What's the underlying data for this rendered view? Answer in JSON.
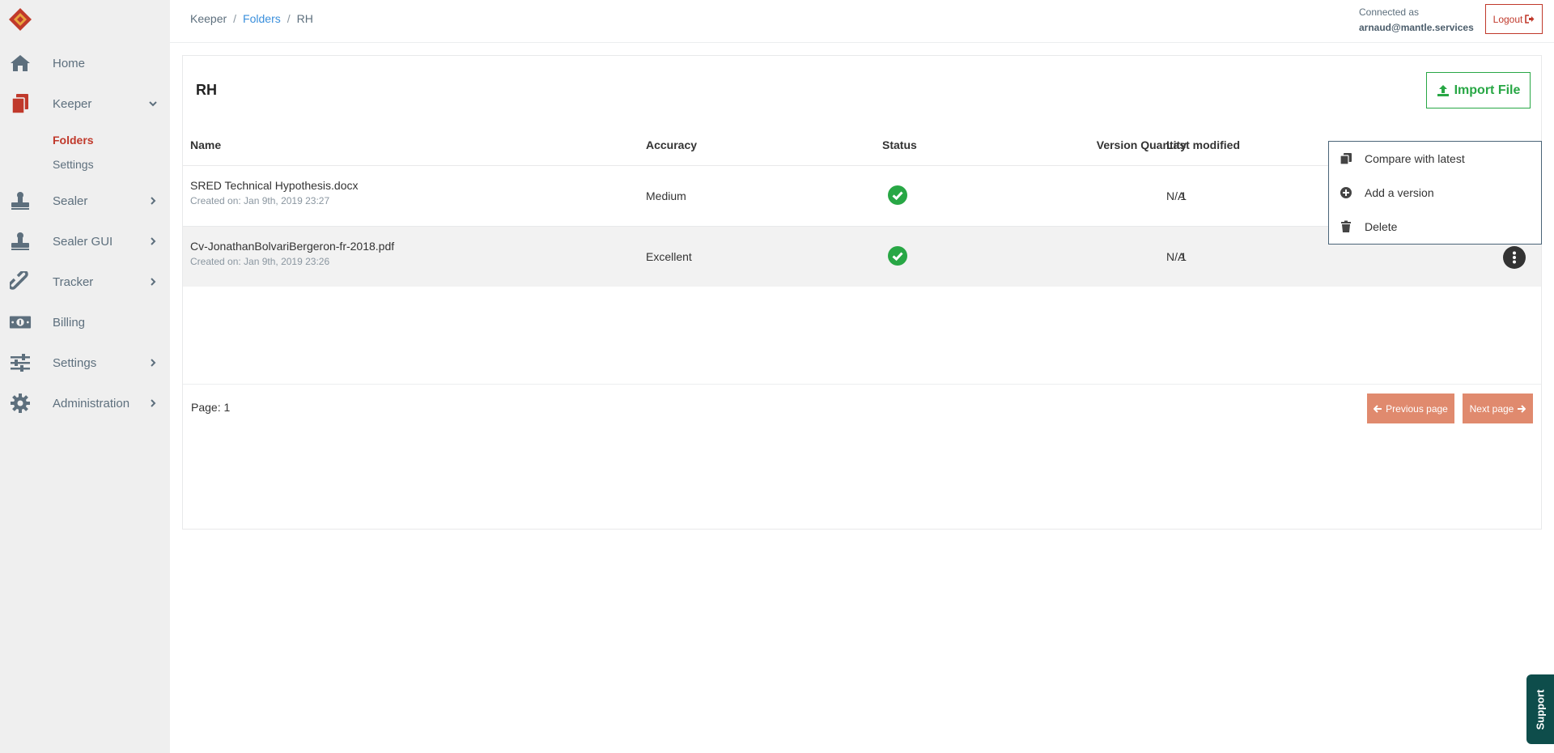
{
  "sidebar": {
    "items": [
      {
        "label": "Home"
      },
      {
        "label": "Keeper"
      },
      {
        "label": "Sealer"
      },
      {
        "label": "Sealer GUI"
      },
      {
        "label": "Tracker"
      },
      {
        "label": "Billing"
      },
      {
        "label": "Settings"
      },
      {
        "label": "Administration"
      }
    ],
    "keeper_sub": [
      {
        "label": "Folders"
      },
      {
        "label": "Settings"
      }
    ]
  },
  "header": {
    "breadcrumb": [
      "Keeper",
      "Folders",
      "RH"
    ],
    "breadcrumb_sep": "/",
    "connected_label": "Connected as",
    "user_email": "arnaud@mantle.services",
    "logout_label": "Logout"
  },
  "folder": {
    "title": "RH",
    "import_label": "Import File"
  },
  "table": {
    "headers": {
      "name": "Name",
      "accuracy": "Accuracy",
      "status": "Status",
      "version_quantity": "Version Quantity",
      "last_modified": "Last modified"
    },
    "rows": [
      {
        "name": "SRED Technical Hypothesis.docx",
        "created": "Created on: Jan 9th, 2019 23:27",
        "accuracy": "Medium",
        "versions": "1",
        "last_modified": "N/A"
      },
      {
        "name": "Cv-JonathanBolvariBergeron-fr-2018.pdf",
        "created": "Created on: Jan 9th, 2019 23:26",
        "accuracy": "Excellent",
        "versions": "1",
        "last_modified": "N/A"
      }
    ]
  },
  "pagination": {
    "page_label": "Page: 1",
    "prev_label": "Previous page",
    "next_label": "Next page"
  },
  "menu": {
    "items": [
      {
        "label": "Compare with latest"
      },
      {
        "label": "Add a version"
      },
      {
        "label": "Delete"
      }
    ]
  },
  "support_label": "Support",
  "colors": {
    "accent_red": "#c0392b",
    "success_green": "#28a745",
    "link_blue": "#3a8fdc",
    "pager_orange": "#e08a6e",
    "support_teal": "#0e4d4b"
  }
}
